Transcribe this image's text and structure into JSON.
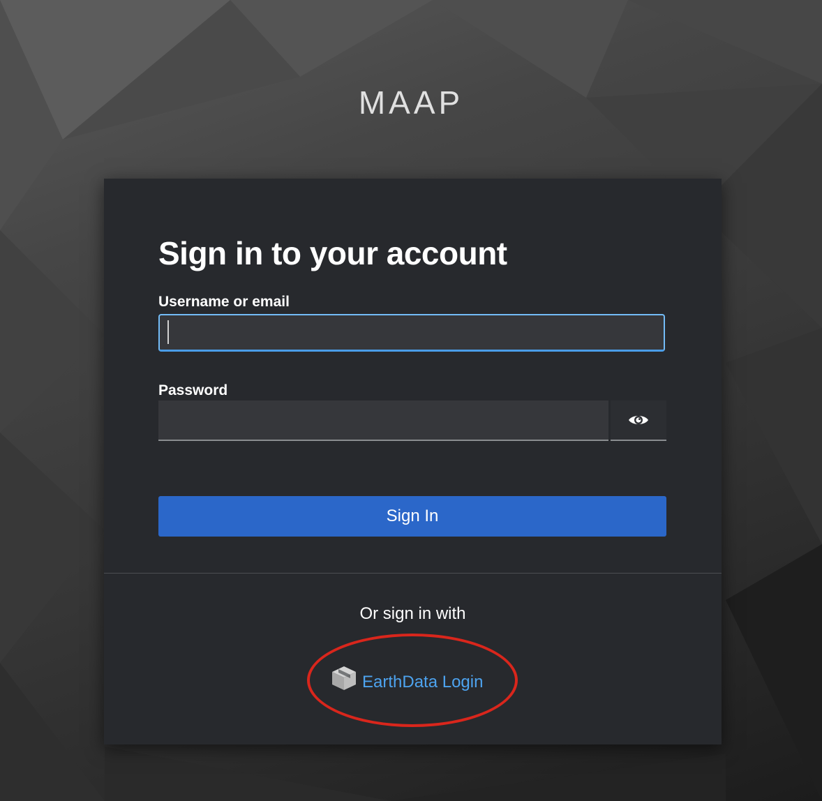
{
  "brand": "MAAP",
  "login": {
    "title": "Sign in to your account",
    "username_label": "Username or email",
    "username_value": "",
    "password_label": "Password",
    "password_value": "",
    "show_password_icon": "eye-icon",
    "submit_label": "Sign In"
  },
  "social": {
    "divider_text": "Or sign in with",
    "providers": [
      {
        "icon": "cube-icon",
        "label": "EarthData Login"
      }
    ]
  },
  "colors": {
    "card_bg": "#27292d",
    "primary_button": "#2b67c9",
    "link": "#4da3ef",
    "annotation_ring": "#d9261c"
  }
}
